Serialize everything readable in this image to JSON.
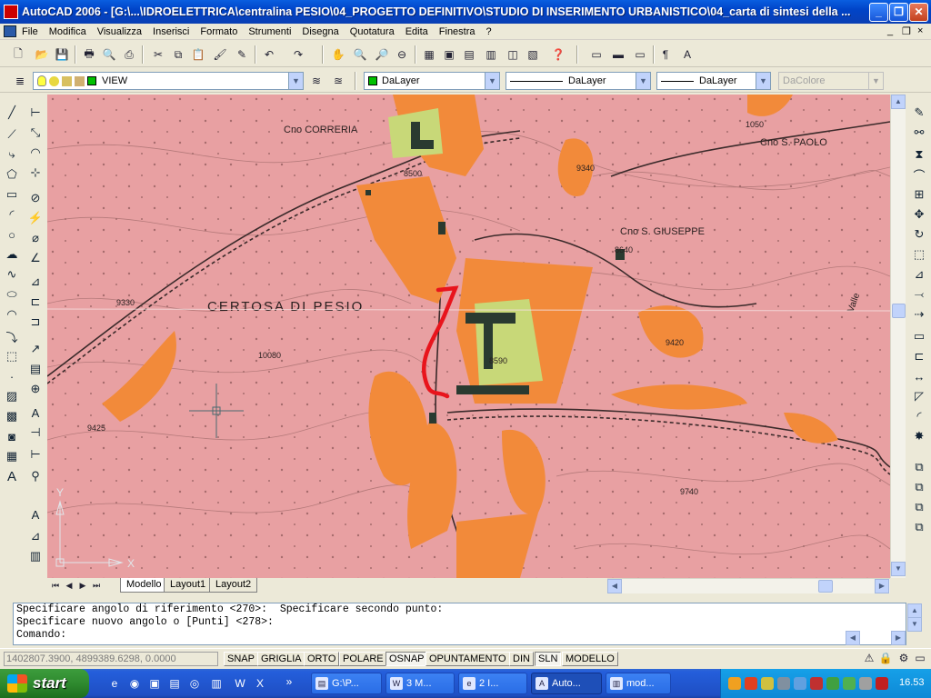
{
  "window": {
    "title": "AutoCAD 2006 - [G:\\...\\IDROELETTRICA\\centralina PESIO\\04_PROGETTO DEFINITIVO\\STUDIO DI INSERIMENTO URBANISTICO\\04_carta di sintesi della ...",
    "minimize": "_",
    "maximize": "❐",
    "close": "✕"
  },
  "menu": {
    "items": [
      "File",
      "Modifica",
      "Visualizza",
      "Inserisci",
      "Formato",
      "Strumenti",
      "Disegna",
      "Quotatura",
      "Edita",
      "Finestra",
      "?"
    ],
    "doc_controls": [
      "_",
      "❐",
      "×"
    ]
  },
  "layers_toolbar": {
    "layer_value": "VIEW",
    "color_value": "DaLayer",
    "linetype_value": "DaLayer",
    "lineweight_value": "DaLayer",
    "plotstyle_value": "DaColore",
    "color_swatch": "#00c000",
    "bulb_color": "#ffff40"
  },
  "map": {
    "labels": [
      {
        "text": "Cno CORRERIA"
      },
      {
        "text": "8500"
      },
      {
        "text": "9340"
      },
      {
        "text": "1050"
      },
      {
        "text": "Cno S. PAOLO"
      },
      {
        "text": "Cno S. GIUSEPPE"
      },
      {
        "text": "8640"
      },
      {
        "text": "9330"
      },
      {
        "text": "CERTOSA DI PESIO"
      },
      {
        "text": "8590"
      },
      {
        "text": "9420"
      },
      {
        "text": "10080"
      },
      {
        "text": "9425"
      },
      {
        "text": "9740"
      },
      {
        "text": "Valle"
      }
    ],
    "colors": {
      "background": "#e8a0a2",
      "orange_zone": "#f28a3a",
      "green_zone": "#c8d878",
      "buildings": "#2a3a30",
      "highlight": "#e8141c"
    }
  },
  "ucs": {
    "x": "X",
    "y": "Y"
  },
  "tabs": [
    "Modello",
    "Layout1",
    "Layout2"
  ],
  "tab_nav": [
    "⏮",
    "◀",
    "▶",
    "⏭"
  ],
  "command": {
    "lines": [
      "Specificare angolo di riferimento <270>:  Specificare secondo punto:",
      "Specificare nuovo angolo o [Punti] <278>:",
      "Comando:"
    ]
  },
  "status": {
    "coords": "1402807.3900, 4899389.6298, 0.0000",
    "toggles": [
      "SNAP",
      "GRIGLIA",
      "ORTO",
      "POLARE",
      "OSNAP",
      "OPUNTAMENTO",
      "DIN",
      "SLN",
      "MODELLO"
    ],
    "active_toggles": [
      "OSNAP",
      "SLN"
    ]
  },
  "taskbar": {
    "start_label": "start",
    "tasks": [
      "G:\\P...",
      "3 M...",
      "2 I...",
      "Auto...",
      "mod..."
    ],
    "active_task": "Auto...",
    "overflow": "»",
    "clock": "16.53"
  }
}
